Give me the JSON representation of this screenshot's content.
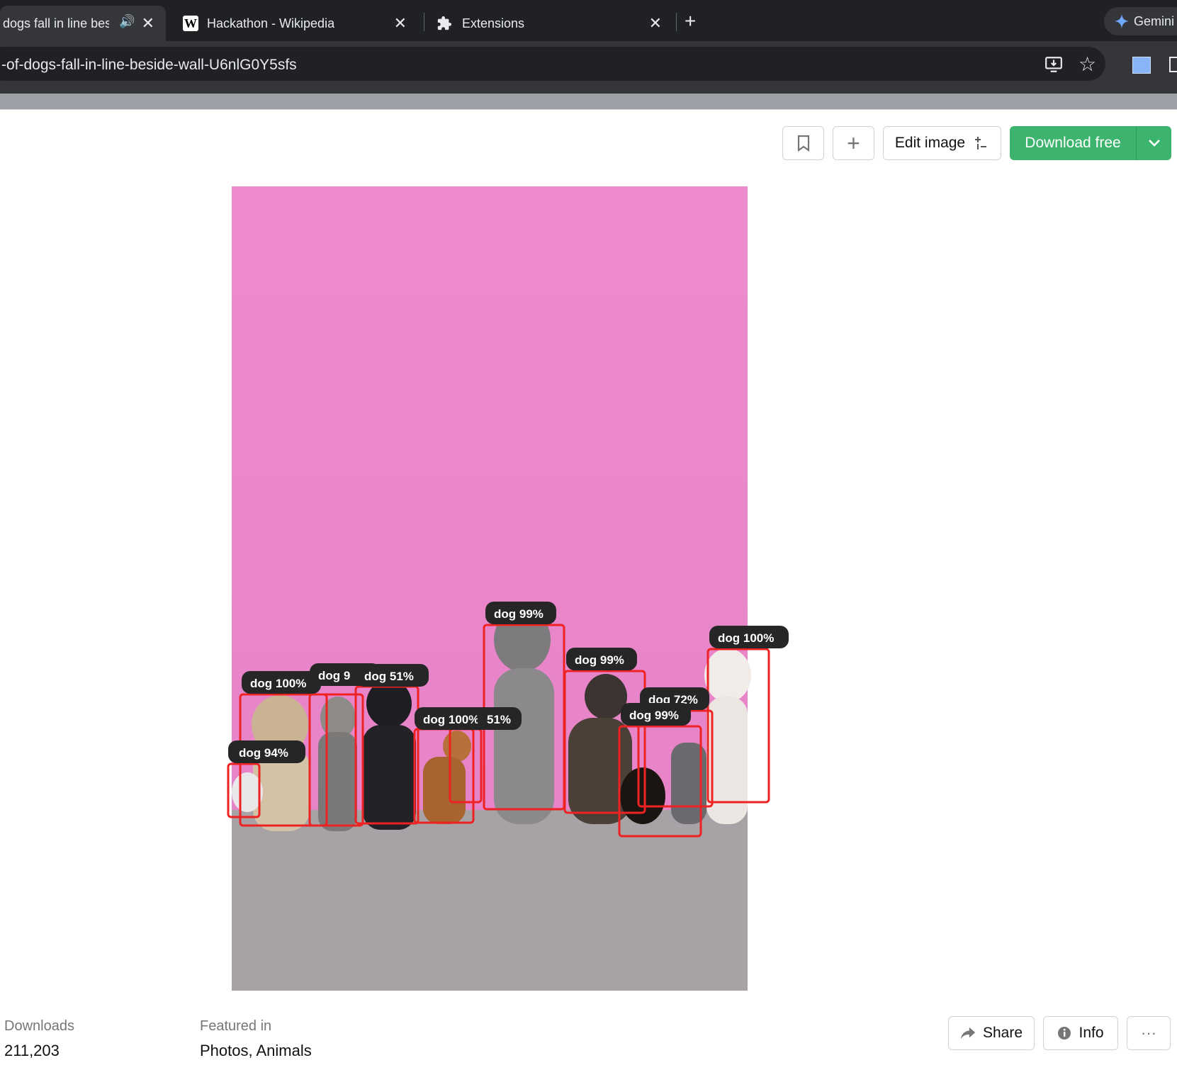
{
  "browser": {
    "tabs": [
      {
        "title": "dogs fall in line bes",
        "active": true
      },
      {
        "title": "Hackathon - Wikipedia",
        "active": false
      },
      {
        "title": "Extensions",
        "active": false
      }
    ],
    "new_tab_symbol": "+",
    "gemini_label": "Gemini",
    "url": "-of-dogs-fall-in-line-beside-wall-U6nlG0Y5sfs"
  },
  "toolbar": {
    "edit_image_label": "Edit image",
    "download_label": "Download free"
  },
  "detections": [
    {
      "label": "dog 100%"
    },
    {
      "label": "dog 94%"
    },
    {
      "label": "dog 9"
    },
    {
      "label": "dog 51%"
    },
    {
      "label": "dog 100%"
    },
    {
      "label": "51%"
    },
    {
      "label": "dog 99%"
    },
    {
      "label": "dog 99%"
    },
    {
      "label": "dog 72%"
    },
    {
      "label": "dog 99%"
    },
    {
      "label": "dog 100%"
    }
  ],
  "footer": {
    "downloads_label": "Downloads",
    "downloads_value": "211,203",
    "featured_label": "Featured in",
    "featured_value": "Photos, Animals",
    "share_label": "Share",
    "info_label": "Info",
    "more_label": "···"
  },
  "colors": {
    "wall": "#ee8bcf",
    "ground": "#a9a4a8",
    "box": "#ee2222",
    "download": "#3cb46e"
  }
}
